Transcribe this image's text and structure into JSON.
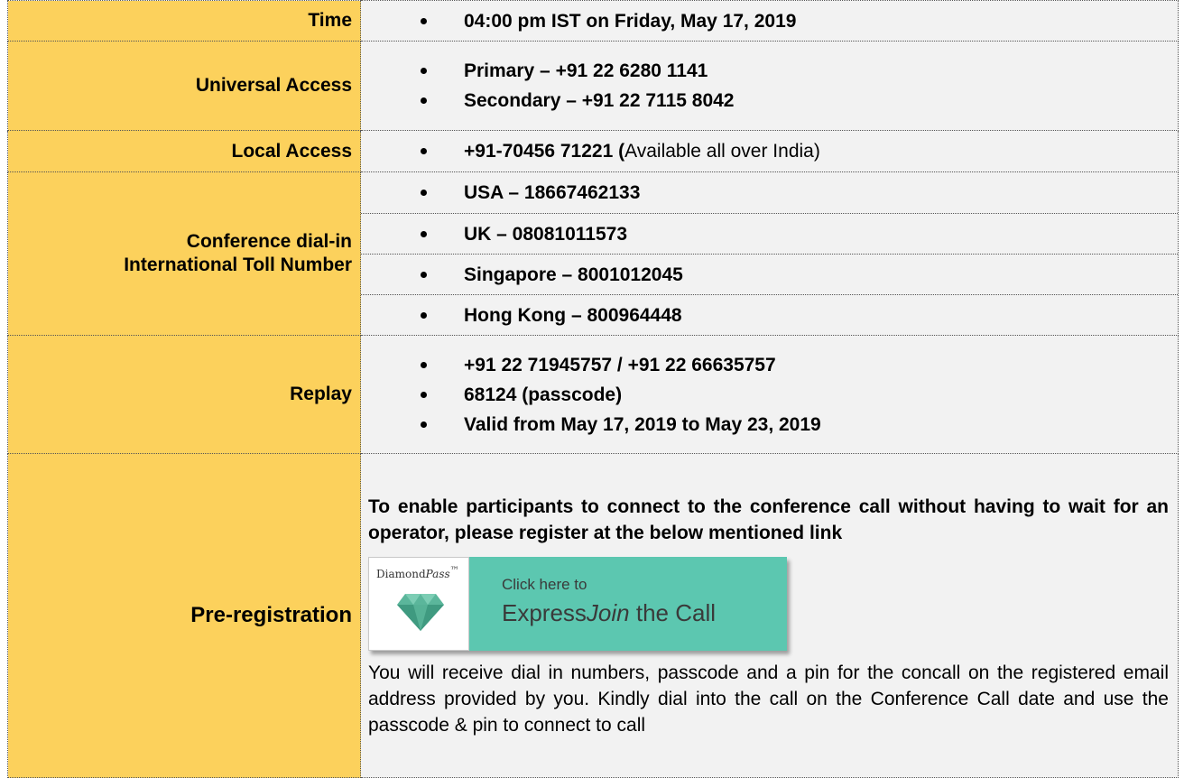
{
  "rows": {
    "time": {
      "label": "Time",
      "items": [
        "04:00 pm IST on Friday, May 17, 2019"
      ]
    },
    "universal": {
      "label": "Universal Access",
      "items": [
        "Primary – +91 22 6280 1141",
        "Secondary – +91 22 7115 8042"
      ]
    },
    "local": {
      "label": "Local Access",
      "number": "+91-70456 71221",
      "paren": "(",
      "note": "Available all over India)"
    },
    "international": {
      "label_line1": "Conference dial-in",
      "label_line2": "International Toll Number",
      "items": [
        "USA – 18667462133",
        "UK – 08081011573",
        "Singapore – 8001012045",
        "Hong Kong – 800964448"
      ]
    },
    "replay": {
      "label": "Replay",
      "items": [
        "+91 22 71945757 / +91 22 66635757",
        "68124 (passcode)",
        "Valid from May 17, 2019 to May 23, 2019"
      ]
    },
    "prereg": {
      "label": "Pre-registration",
      "intro": "To enable participants to connect to the conference call without having to wait for an operator, please register at the below mentioned link",
      "note": "You will receive dial in numbers, passcode and a pin for the concall on the registered email address provided by you. Kindly dial into the call on the Conference Call date and use the passcode & pin to connect to call"
    }
  },
  "banner": {
    "brand_prefix": "Diamond",
    "brand_italic": "Pass",
    "brand_tm": "™",
    "line1": "Click here to",
    "line2_prefix": "Express",
    "line2_italic": "Join",
    "line2_suffix": " the Call",
    "accent_color": "#5cc7b0",
    "diamond_icon": "diamond-icon"
  },
  "colors": {
    "label_bg": "#fcd15c",
    "value_bg": "#f2f2f2"
  }
}
